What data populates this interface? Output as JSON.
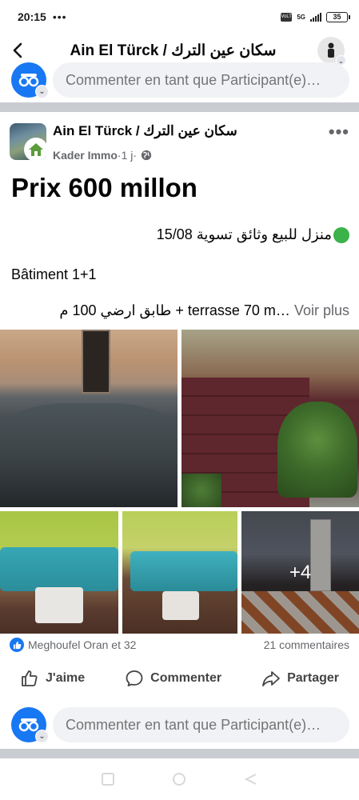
{
  "status_bar": {
    "time": "20:15",
    "dots": "•••",
    "volte": "VoLTE",
    "network": "5G",
    "battery": "35"
  },
  "top_nav": {
    "title": "Ain El Türck / سكان عين الترك"
  },
  "comment_input": {
    "placeholder": "Commenter en tant que Participant(e)…"
  },
  "post": {
    "group_name": "Ain El Türck / سكان عين الترك",
    "author": "Kader Immo",
    "separator": " · ",
    "time": "1 j",
    "separator2": " · ",
    "title": "Prix 600 millon",
    "line1": "منزل للبيع وثائق تسوية 15/08",
    "line2": "Bâtiment 1+1",
    "line3_text": "طابق ارضي 100 م + terrasse 70 m…",
    "voir_plus": "Voir plus",
    "more_photos": "+4"
  },
  "engagement": {
    "reactions_text": "Meghoufel Oran et 32",
    "comments_text": "21 commentaires"
  },
  "actions": {
    "like": "J'aime",
    "comment": "Commenter",
    "share": "Partager"
  },
  "colors": {
    "accent": "#1877f2",
    "separator": "#c9ccd1",
    "input_bg": "#f0f2f5",
    "muted_text": "#65676b",
    "status_dot": "#3bb24a"
  },
  "icons": {
    "back": "back-arrow-icon",
    "more": "more-horizontal-icon",
    "globe": "globe-icon",
    "like": "thumbs-up-icon",
    "comment": "comment-bubble-icon",
    "share": "share-arrow-icon"
  }
}
